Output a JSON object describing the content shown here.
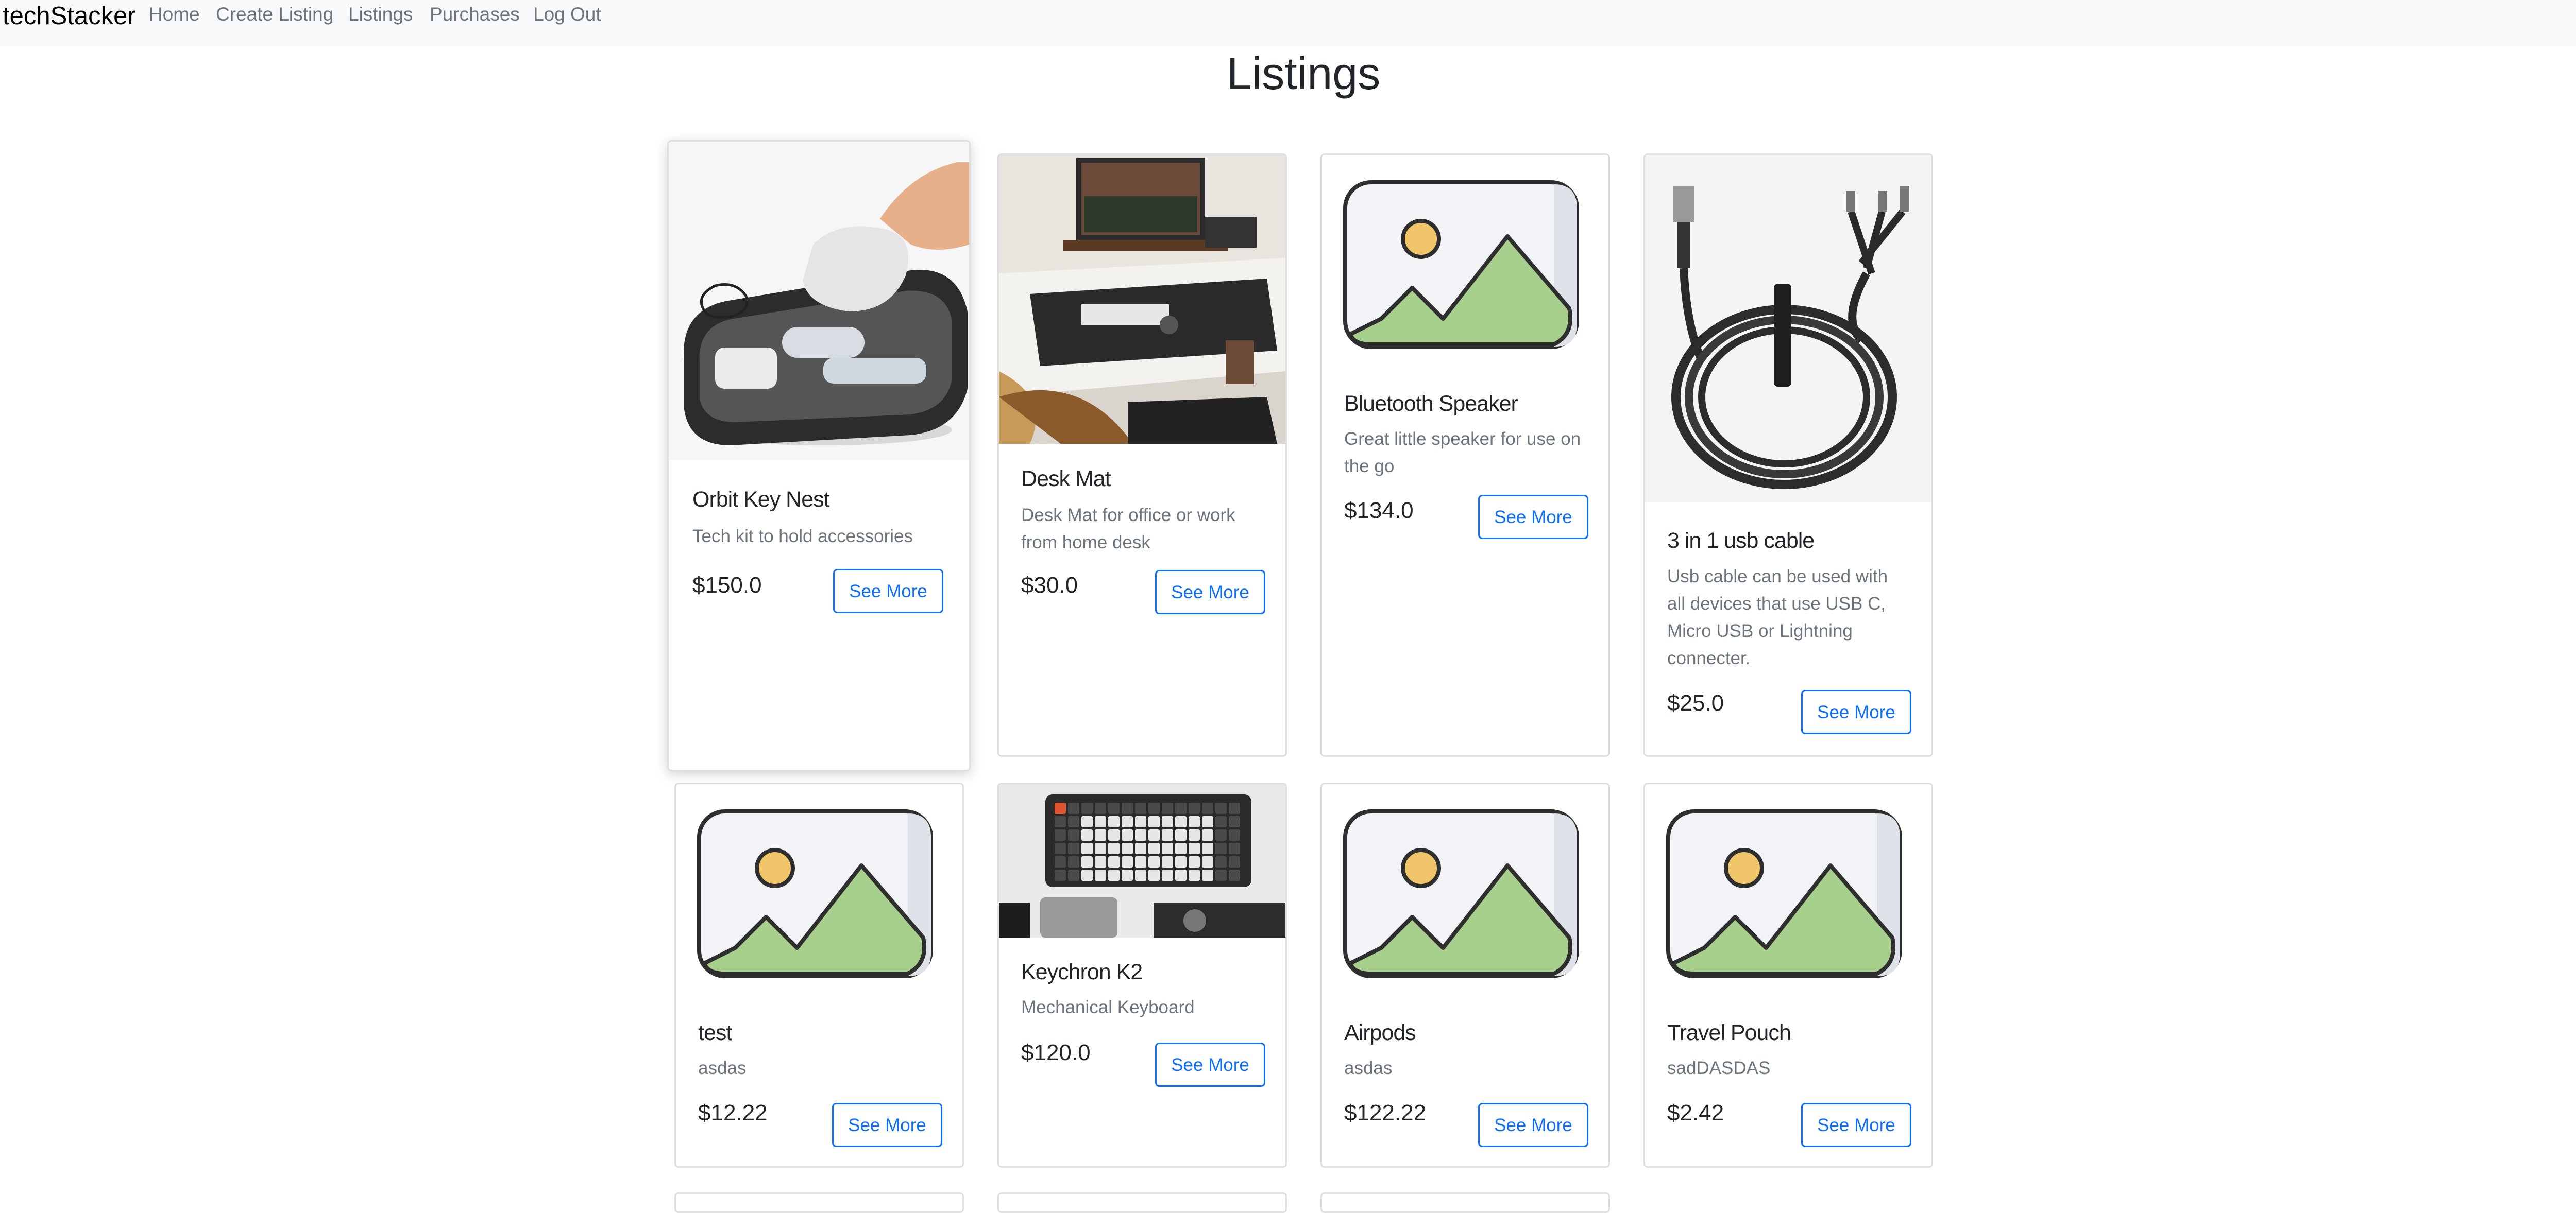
{
  "nav": {
    "brand": "techStacker",
    "links": [
      "Home",
      "Create Listing",
      "Listings",
      "Purchases",
      "Log Out"
    ]
  },
  "page": {
    "title": "Listings"
  },
  "listings": [
    {
      "title": "Orbit Key Nest",
      "description": "Tech kit to hold accessories",
      "price": "$150.0",
      "button": "See More"
    },
    {
      "title": "Desk Mat",
      "description": "Desk Mat for office or work from home desk",
      "price": "$30.0",
      "button": "See More"
    },
    {
      "title": "Bluetooth Speaker",
      "description": "Great little speaker for use on the go",
      "price": "$134.0",
      "button": "See More"
    },
    {
      "title": "3 in 1 usb cable",
      "description": "Usb cable can be used with all devices that use USB C, Micro USB or Lightning connecter.",
      "price": "$25.0",
      "button": "See More"
    },
    {
      "title": "test",
      "description": "asdas",
      "price": "$12.22",
      "button": "See More"
    },
    {
      "title": "Keychron K2",
      "description": "Mechanical Keyboard",
      "price": "$120.0",
      "button": "See More"
    },
    {
      "title": "Airpods",
      "description": "asdas",
      "price": "$122.22",
      "button": "See More"
    },
    {
      "title": "Travel Pouch",
      "description": "sadDASDAS",
      "price": "$2.42",
      "button": "See More"
    }
  ],
  "colors": {
    "primary": "#0d6efd",
    "muted": "#6c757d",
    "navbar_bg": "#f8f9fa",
    "placeholder_green": "#a8d08d",
    "placeholder_sun": "#f1c66b"
  },
  "icons": {
    "placeholder": "image-placeholder-icon"
  }
}
